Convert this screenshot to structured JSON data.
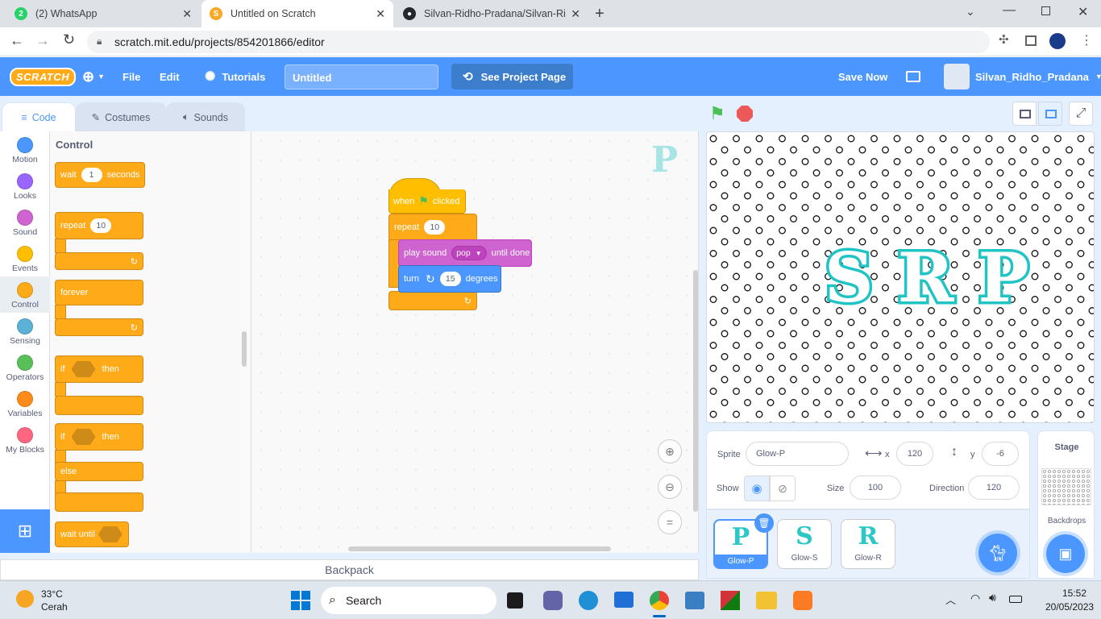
{
  "browser": {
    "tabs": [
      {
        "title": "(2) WhatsApp",
        "icon": "whatsapp-icon",
        "color": "#25d366"
      },
      {
        "title": "Untitled on Scratch",
        "icon": "scratch-icon",
        "color": "#f9a825"
      },
      {
        "title": "Silvan-Ridho-Pradana/Silvan-Ridh",
        "icon": "github-icon",
        "color": "#24292f"
      }
    ],
    "url": "scratch.mit.edu/projects/854201866/editor"
  },
  "menubar": {
    "logo": "SCRATCH",
    "file": "File",
    "edit": "Edit",
    "tutorials": "Tutorials",
    "project_title": "Untitled",
    "see_project": "See Project Page",
    "save_now": "Save Now",
    "username": "Silvan_Ridho_Pradana"
  },
  "editor_tabs": {
    "code": "Code",
    "costumes": "Costumes",
    "sounds": "Sounds"
  },
  "categories": [
    {
      "label": "Motion",
      "color": "#4c97ff"
    },
    {
      "label": "Looks",
      "color": "#9966ff"
    },
    {
      "label": "Sound",
      "color": "#cf63cf"
    },
    {
      "label": "Events",
      "color": "#ffbf00"
    },
    {
      "label": "Control",
      "color": "#ffab19"
    },
    {
      "label": "Sensing",
      "color": "#5cb1d6"
    },
    {
      "label": "Operators",
      "color": "#59c059"
    },
    {
      "label": "Variables",
      "color": "#ff8c1a"
    },
    {
      "label": "My Blocks",
      "color": "#ff6680"
    }
  ],
  "palette": {
    "heading": "Control",
    "wait": {
      "pre": "wait",
      "value": "1",
      "post": "seconds"
    },
    "repeat": {
      "label": "repeat",
      "value": "10"
    },
    "forever": "forever",
    "if_then": {
      "if": "if",
      "then": "then"
    },
    "if_else": {
      "if": "if",
      "then": "then",
      "else": "else"
    },
    "wait_until": "wait until"
  },
  "script": {
    "hat": {
      "when": "when",
      "clicked": "clicked"
    },
    "repeat": {
      "label": "repeat",
      "value": "10"
    },
    "play_sound": {
      "label": "play sound",
      "sound": "pop",
      "post": "until done"
    },
    "turn": {
      "label": "turn",
      "value": "15",
      "post": "degrees"
    }
  },
  "workspace_sprite_letter": "P",
  "backpack": "Backpack",
  "stage_text": "SRP",
  "sprite_info": {
    "sprite_label": "Sprite",
    "sprite_name": "Glow-P",
    "x_label": "x",
    "x": "120",
    "y_label": "y",
    "y": "-6",
    "show_label": "Show",
    "size_label": "Size",
    "size": "100",
    "direction_label": "Direction",
    "direction": "120"
  },
  "sprites": [
    {
      "name": "Glow-P",
      "glyph": "P"
    },
    {
      "name": "Glow-S",
      "glyph": "S"
    },
    {
      "name": "Glow-R",
      "glyph": "R"
    }
  ],
  "stage_pane": {
    "title": "Stage",
    "backdrops": "Backdrops"
  },
  "taskbar": {
    "temp": "33°C",
    "weather": "Cerah",
    "search": "Search",
    "time": "15:52",
    "date": "20/05/2023"
  }
}
